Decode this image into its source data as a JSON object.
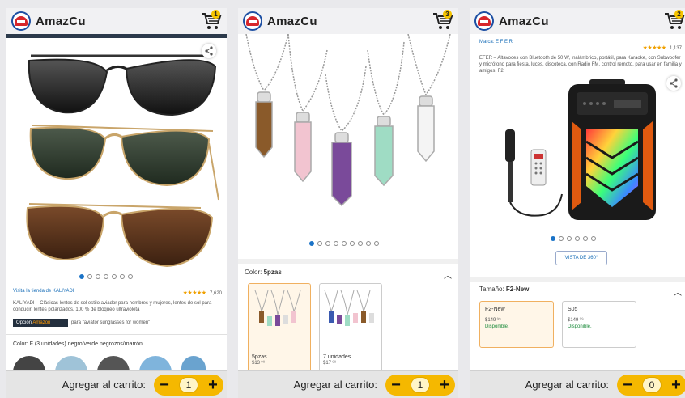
{
  "app": {
    "brand": "AmazCu"
  },
  "bottom_bar": {
    "add_label": "Agregar al carrito:"
  },
  "screens": [
    {
      "cart_count": "1",
      "quantity": "1",
      "store_link": "Visita la tienda de KALIYADI",
      "rating_count": "7,620",
      "description": "KALIYADI – Clásicas lentes de sol estilo aviador para hombres y mujeres, lentes de sol para conducir, lentes polarizados, 100 % de bloqueo ultravioleta",
      "badge_prefix": "Opción",
      "badge_brand": "Amazon",
      "badge_text": "para \"aviator sunglasses for women\"",
      "color_label": "Color: F (3 unidades) negro/verde negrozos/marrón"
    },
    {
      "cart_count": "3",
      "quantity": "1",
      "color_label": "Color:",
      "color_value": "5pzas",
      "options": [
        {
          "name": "5pzas",
          "price": "$13 ⁹⁹"
        },
        {
          "name": "7 unidades.",
          "price": "$17 ⁹⁹"
        }
      ]
    },
    {
      "cart_count": "2",
      "quantity": "0",
      "brand_line": "Marca: E F E R",
      "rating_count": "1,137",
      "description": "EFER – Altavoces con Bluetooth de 50 W, inalámbrico, portátil, para Karaoke, con Subwoofer y micrófono para fiesta, luces, discoteca, con Radio FM, control remoto, para usar en familia y amigos, F2",
      "view_360": "VISTA DE 360°",
      "size_label": "Tamaño:",
      "size_value": "F2-New",
      "options": [
        {
          "name": "F2-New",
          "price": "$149 ⁹⁹",
          "status": "Disponible."
        },
        {
          "name": "S05",
          "price": "$149 ⁹⁹",
          "status": "Disponible."
        }
      ]
    }
  ]
}
